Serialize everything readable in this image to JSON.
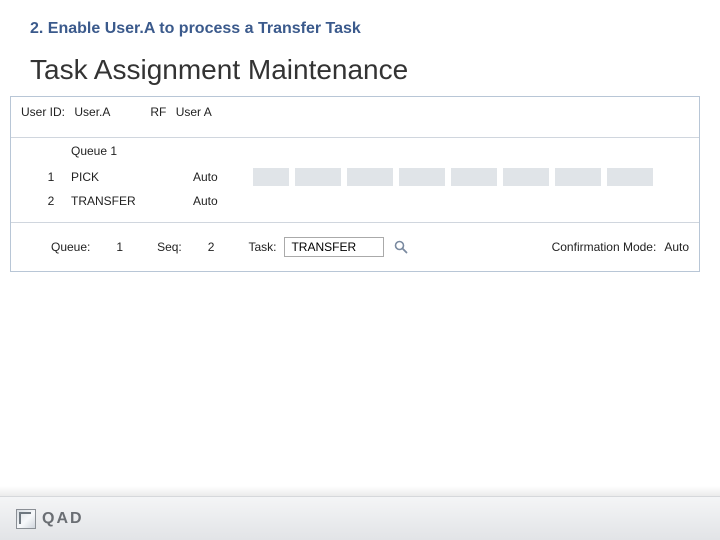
{
  "step_title": "2. Enable User.A to process a Transfer Task",
  "page_title": "Task Assignment Maintenance",
  "user_row": {
    "user_id_label": "User ID:",
    "user_id_value": "User.A",
    "rf_label": "RF",
    "rf_value": "User A"
  },
  "queue_header": "Queue 1",
  "rows": [
    {
      "num": "1",
      "task": "PICK",
      "mode": "Auto"
    },
    {
      "num": "2",
      "task": "TRANSFER",
      "mode": "Auto"
    }
  ],
  "form": {
    "queue_label": "Queue:",
    "queue_value": "1",
    "seq_label": "Seq:",
    "seq_value": "2",
    "task_label": "Task:",
    "task_value": "TRANSFER",
    "conf_label": "Confirmation Mode:",
    "conf_value": "Auto"
  },
  "brand": "QAD"
}
